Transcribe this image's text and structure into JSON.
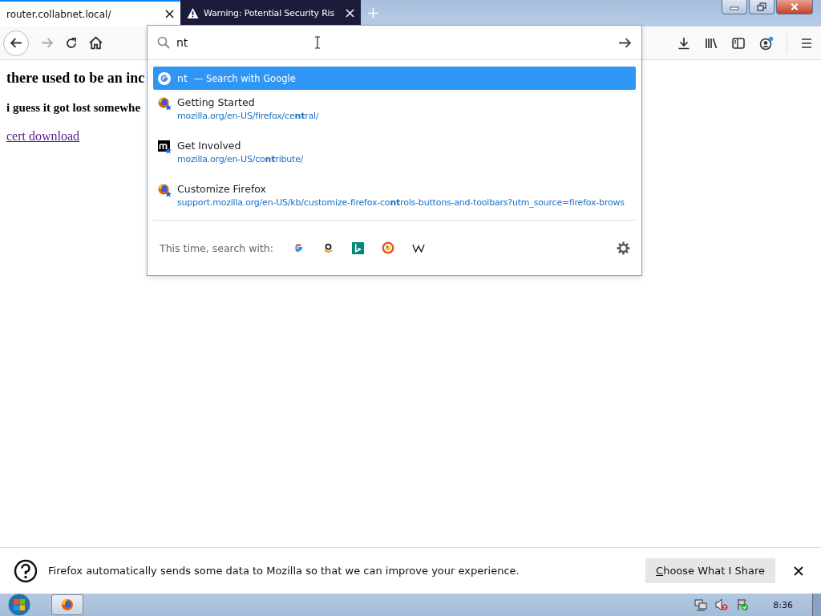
{
  "tabs": [
    {
      "title": "router.collabnet.local/",
      "selected": true,
      "kind": "page"
    },
    {
      "title": "Warning: Potential Security Ris",
      "selected": false,
      "kind": "warning"
    }
  ],
  "address_bar": {
    "value": "nt"
  },
  "page": {
    "heading": "there used to be an inc",
    "subheading": "i guess it got lost somewhe",
    "link": "cert download"
  },
  "suggestions": [
    {
      "kind": "search",
      "query": "nt",
      "action": "— Search with Google",
      "selected": true
    },
    {
      "kind": "bookmark",
      "title": "Getting Started",
      "url": "mozilla.org/en-US/firefox/ce**nt**ral/",
      "selected": false
    },
    {
      "kind": "bookmark",
      "title": "Get Involved",
      "url": "mozilla.org/en-US/co**nt**ribute/",
      "selected": false
    },
    {
      "kind": "bookmark",
      "title": "Customize Firefox",
      "url": "support.mozilla.org/en-US/kb/customize-firefox-co**nt**rols-buttons-and-toolbars?utm_source=firefox-brows",
      "selected": false
    }
  ],
  "search_with": {
    "label": "This time, search with:"
  },
  "notification": {
    "text": "Firefox automatically sends some data to Mozilla so that we can improve your experience.",
    "button": "Choose What I Share"
  },
  "taskbar": {
    "clock": "8:36"
  }
}
